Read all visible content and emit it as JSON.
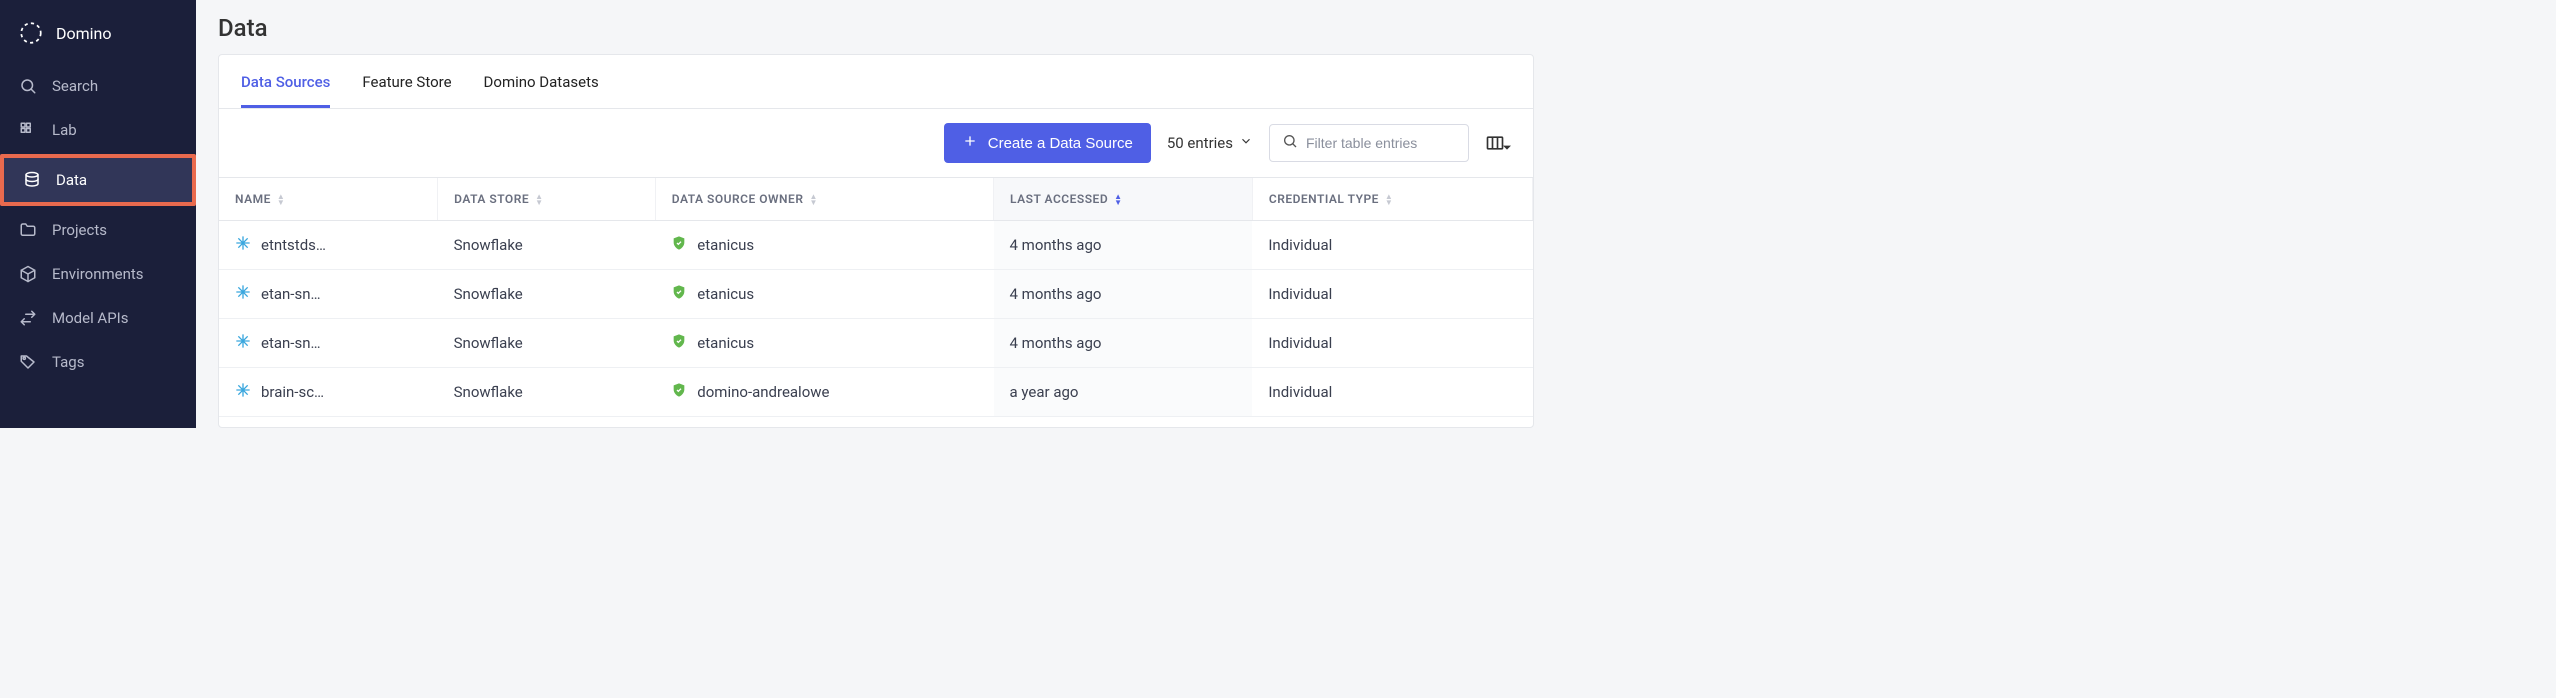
{
  "brand": {
    "name": "Domino"
  },
  "sidebar": {
    "items": [
      {
        "label": "Search",
        "icon": "search-icon",
        "active": false
      },
      {
        "label": "Lab",
        "icon": "grid-icon",
        "active": false
      },
      {
        "label": "Data",
        "icon": "database-icon",
        "active": true,
        "highlight": true
      },
      {
        "label": "Projects",
        "icon": "folder-icon",
        "active": false
      },
      {
        "label": "Environments",
        "icon": "cube-icon",
        "active": false
      },
      {
        "label": "Model APIs",
        "icon": "swap-icon",
        "active": false
      },
      {
        "label": "Tags",
        "icon": "tag-icon",
        "active": false
      }
    ]
  },
  "page": {
    "title": "Data"
  },
  "tabs": [
    {
      "label": "Data Sources",
      "active": true
    },
    {
      "label": "Feature Store",
      "active": false
    },
    {
      "label": "Domino Datasets",
      "active": false
    }
  ],
  "toolbar": {
    "create_label": "Create a Data Source",
    "entries_label": "50 entries",
    "filter_placeholder": "Filter table entries"
  },
  "table": {
    "columns": [
      {
        "label": "NAME",
        "sorted": false
      },
      {
        "label": "DATA STORE",
        "sorted": false
      },
      {
        "label": "DATA SOURCE OWNER",
        "sorted": false
      },
      {
        "label": "LAST ACCESSED",
        "sorted": true
      },
      {
        "label": "CREDENTIAL TYPE",
        "sorted": false
      }
    ],
    "rows": [
      {
        "name": "etntstds…",
        "store": "Snowflake",
        "owner": "etanicus",
        "last": "4 months ago",
        "cred": "Individual"
      },
      {
        "name": "etan-sn…",
        "store": "Snowflake",
        "owner": "etanicus",
        "last": "4 months ago",
        "cred": "Individual"
      },
      {
        "name": "etan-sn…",
        "store": "Snowflake",
        "owner": "etanicus",
        "last": "4 months ago",
        "cred": "Individual"
      },
      {
        "name": "brain-sc…",
        "store": "Snowflake",
        "owner": "domino-andrealowe",
        "last": "a year ago",
        "cred": "Individual"
      }
    ]
  }
}
